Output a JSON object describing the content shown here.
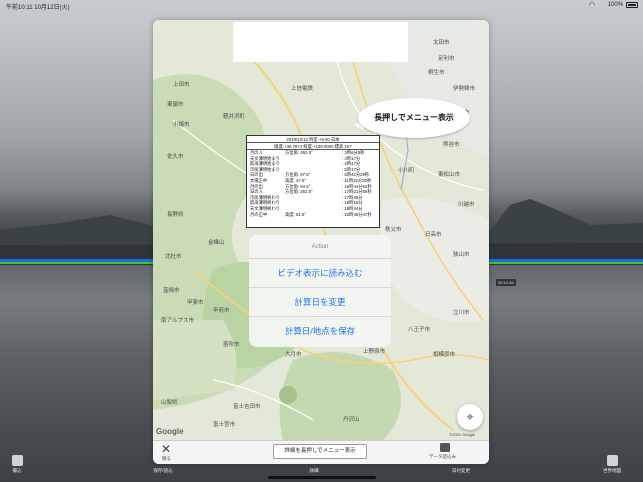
{
  "status_bar": {
    "time": "午前10:11  10月12日(火)",
    "battery_text": "100%"
  },
  "map": {
    "cities": [
      "上信電鉄",
      "太田市",
      "足利市",
      "桐生市",
      "伊勢崎市",
      "館林市",
      "小川町",
      "東松山市",
      "熊谷市",
      "川越市",
      "日高市",
      "狭山市",
      "立川市",
      "八王子市",
      "相模原市",
      "秩父市",
      "甲府市",
      "笛吹市",
      "富士吉田市",
      "大月市",
      "上野原市",
      "南アルプス市",
      "韮崎市",
      "山梨県",
      "富士宮市",
      "甲斐市",
      "北杜市",
      "佐久市",
      "小諸市",
      "上田市",
      "東御市",
      "軽井沢町",
      "金峰山",
      "長野県",
      "丹沢山"
    ],
    "google": "Google",
    "copyright": "©2021 Google"
  },
  "bubble_text": "長押しでメニュー表示",
  "info": {
    "header1": "2019/10/12 時差:+9.00 日本",
    "header2": "緯度:+35.7874 経度:+139.0000 標高:10?",
    "rows": [
      {
        "label": "月の入",
        "az": "方位角: 262.9°",
        "val": ": 3時6分8秒"
      },
      {
        "label": "天文薄明始まり",
        "az": "",
        "val": ": 4時17分"
      },
      {
        "label": "航海薄明始まり",
        "az": "",
        "val": ": 4時47分"
      },
      {
        "label": "市民薄明始まり",
        "az": "",
        "val": ": 5時17分"
      },
      {
        "label": "日の出",
        "az": "方位角:  97.5°",
        "val": ": 5時42分29秒"
      },
      {
        "label": "太陽正中",
        "az": "高度:  47.8°",
        "val": ": 11時32分30秒"
      },
      {
        "label": "月の出",
        "az": "方位角:  94.6°",
        "val": ": 16時44分52秒"
      },
      {
        "label": "日の入",
        "az": "方位角: 262.8°",
        "val": ": 17時21分59秒"
      },
      {
        "label": "市民薄明終わり",
        "az": "",
        "val": ": 17時45分"
      },
      {
        "label": "航海薄明終わり",
        "az": "",
        "val": ": 18時15分"
      },
      {
        "label": "天文薄明終わり",
        "az": "",
        "val": ": 18時44分"
      },
      {
        "label": "月の正中",
        "az": "高度:  51.5°",
        "val": ": 22時48分47秒"
      }
    ]
  },
  "action_sheet": {
    "title": "Action",
    "items": [
      "ビデオ表示に読み込む",
      "計算日を変更",
      "計算日/地点を保存"
    ]
  },
  "map_bottom": {
    "close_label": "閉る",
    "hint": "詳細を長押しでメニュー表示",
    "data_label": "データ読込み"
  },
  "toolbar": {
    "items": [
      "撮込",
      "保存/読込",
      "詳細",
      "日付変更",
      "世界地図"
    ]
  },
  "side_label": "00:12:48",
  "colors": {
    "action_text": "#1a73e8",
    "water_line_blue": "#1e6be0",
    "water_line_green": "#38c838"
  }
}
